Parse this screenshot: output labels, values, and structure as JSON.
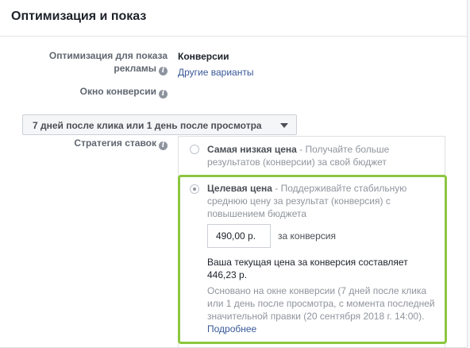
{
  "header": {
    "title": "Оптимизация и показ"
  },
  "optimization": {
    "label_line1": "Оптимизация для показа",
    "label_line2": "рекламы",
    "value": "Конверсии",
    "other_link": "Другие варианты"
  },
  "conversion_window": {
    "label": "Окно конверсии",
    "dropdown_value": "7 дней после клика или 1 день после просмотра"
  },
  "bid_strategy": {
    "label": "Стратегия ставок",
    "options": [
      {
        "title": "Самая низкая цена",
        "description": " - Получайте больше результатов (конверсии) за свой бюджет",
        "selected": false
      },
      {
        "title": "Целевая цена",
        "description": " - Поддерживайте стабильную среднюю цену за результат (конверсия) с повышением бюджета",
        "selected": true
      }
    ],
    "bid_value": "490,00 р.",
    "per_conversion": "за конверсия",
    "current_price": "Ваша текущая цена за конверсия составляет 446,23 р.",
    "note": "Основано на окне конверсии (7 дней после клика или 1 день после просмотра, с момента последней значительной правки (20 сентября 2018 г. 14:00). ",
    "learn_more": "Подробнее"
  },
  "colors": {
    "highlight_border": "#8cc63f",
    "link": "#385898",
    "label": "#606770"
  },
  "icons": {
    "info": "info-icon",
    "caret": "caret-down-icon"
  }
}
